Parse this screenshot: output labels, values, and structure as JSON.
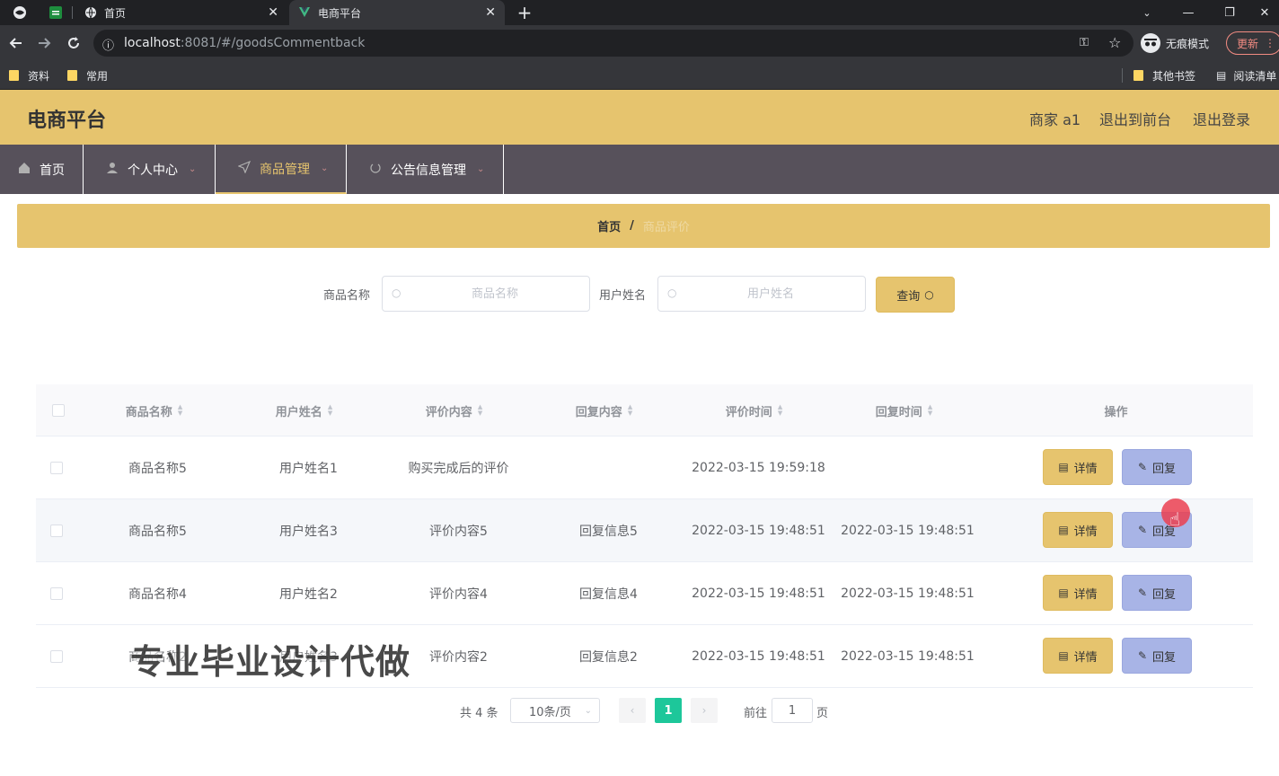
{
  "browser": {
    "tabs": [
      {
        "title": "首页",
        "active": false
      },
      {
        "title": "电商平台",
        "active": true
      }
    ],
    "url_host": "localhost",
    "url_path": ":8081/#/goodsCommentback",
    "incognito_label": "无痕模式",
    "update_label": "更新",
    "bookmarks": [
      "资料",
      "常用"
    ],
    "other_bookmarks": "其他书签",
    "reading_list": "阅读清单"
  },
  "header": {
    "title": "电商平台",
    "user": "商家 a1",
    "to_front": "退出到前台",
    "logout": "退出登录"
  },
  "menu": [
    {
      "label": "首页",
      "icon": "home-icon"
    },
    {
      "label": "个人中心",
      "icon": "user-icon"
    },
    {
      "label": "商品管理",
      "icon": "send-icon"
    },
    {
      "label": "公告信息管理",
      "icon": "power-icon"
    }
  ],
  "breadcrumb": {
    "home": "首页",
    "sep": "/",
    "current": "商品评价"
  },
  "search": {
    "goods_label": "商品名称",
    "goods_placeholder": "商品名称",
    "user_label": "用户姓名",
    "user_placeholder": "用户姓名",
    "query_label": "查询"
  },
  "table": {
    "columns": [
      "商品名称",
      "用户姓名",
      "评价内容",
      "回复内容",
      "评价时间",
      "回复时间",
      "操作"
    ],
    "rows": [
      {
        "goods": "商品名称5",
        "user": "用户姓名1",
        "content": "购买完成后的评价",
        "reply": "",
        "time": "2022-03-15 19:59:18",
        "reply_time": ""
      },
      {
        "goods": "商品名称5",
        "user": "用户姓名3",
        "content": "评价内容5",
        "reply": "回复信息5",
        "time": "2022-03-15 19:48:51",
        "reply_time": "2022-03-15 19:48:51"
      },
      {
        "goods": "商品名称4",
        "user": "用户姓名2",
        "content": "评价内容4",
        "reply": "回复信息4",
        "time": "2022-03-15 19:48:51",
        "reply_time": "2022-03-15 19:48:51"
      },
      {
        "goods": "商品名称2",
        "user": "用户姓名3",
        "content": "评价内容2",
        "reply": "回复信息2",
        "time": "2022-03-15 19:48:51",
        "reply_time": "2022-03-15 19:48:51"
      }
    ],
    "detail_label": "详情",
    "reply_label": "回复"
  },
  "pagination": {
    "total": "共 4 条",
    "page_size": "10条/页",
    "current_page": "1",
    "goto": "前往",
    "jump_value": "1",
    "page_suffix": "页"
  },
  "watermark": "专业毕业设计代做",
  "colors": {
    "accent": "#e6c46e",
    "nav": "#57515b",
    "reply_btn": "#a8b4e6",
    "page_active": "#1dc79a"
  }
}
